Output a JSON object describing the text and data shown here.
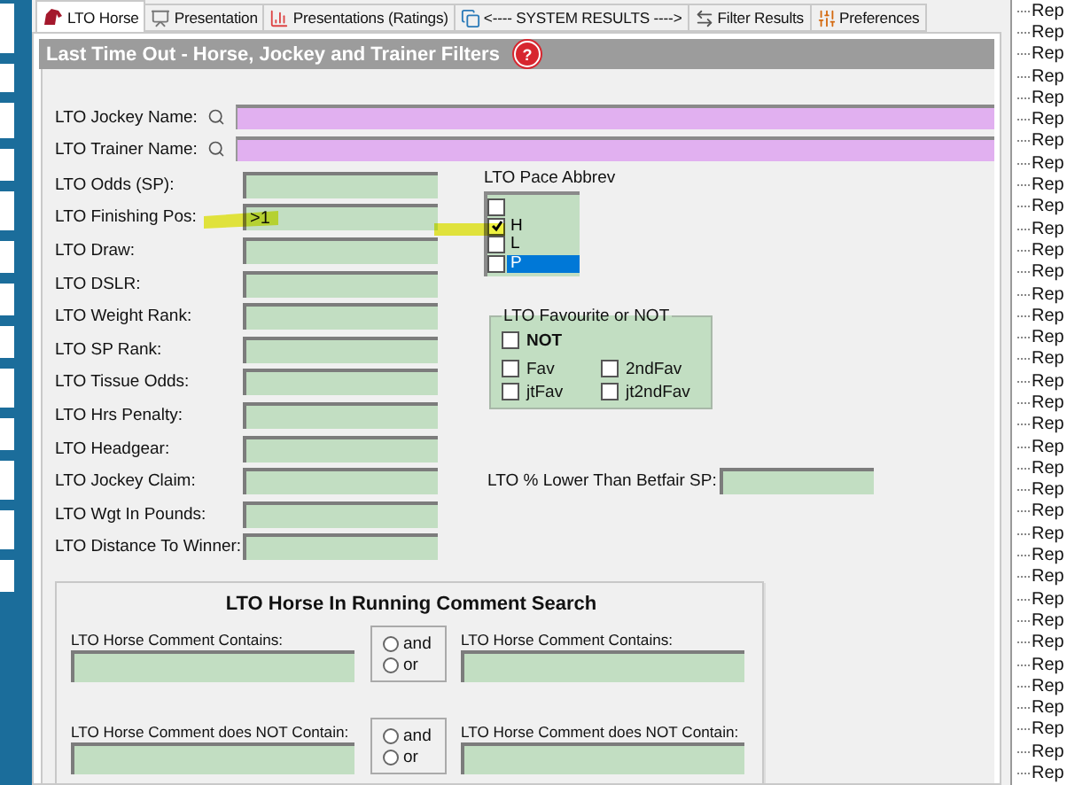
{
  "tabs": [
    {
      "label": "LTO Horse",
      "selected": true
    },
    {
      "label": "Presentation",
      "selected": false
    },
    {
      "label": "Presentations (Ratings)",
      "selected": false
    },
    {
      "label": "<---- SYSTEM RESULTS ---->",
      "selected": false
    },
    {
      "label": "Filter Results",
      "selected": false
    },
    {
      "label": "Preferences",
      "selected": false
    }
  ],
  "header": {
    "title": "Last Time Out - Horse, Jockey and Trainer Filters",
    "help": "?"
  },
  "name_filters": [
    {
      "label": "LTO Jockey Name:"
    },
    {
      "label": "LTO Trainer Name:"
    }
  ],
  "filters": [
    {
      "label": "LTO Odds (SP):"
    },
    {
      "label": "LTO Finishing Pos:",
      "value": ">1"
    },
    {
      "label": "LTO Draw:"
    },
    {
      "label": "LTO DSLR:"
    },
    {
      "label": "LTO Weight Rank:"
    },
    {
      "label": "LTO SP Rank:"
    },
    {
      "label": "LTO Tissue Odds:"
    },
    {
      "label": "LTO Hrs Penalty:"
    },
    {
      "label": "LTO Headgear:"
    },
    {
      "label": "LTO Jockey Claim:"
    },
    {
      "label": "LTO Wgt In Pounds:"
    },
    {
      "label": "LTO Distance To Winner:"
    }
  ],
  "pace": {
    "label": "LTO Pace Abbrev",
    "options": [
      {
        "checked": false,
        "selected": false
      },
      {
        "label": "H",
        "checked": true,
        "selected": false
      },
      {
        "label": "L",
        "checked": false,
        "selected": false
      },
      {
        "label": "P",
        "checked": false,
        "selected": true
      }
    ]
  },
  "favourite": {
    "title": "LTO Favourite or NOT",
    "not": {
      "label": "NOT",
      "checked": false
    },
    "options": [
      {
        "label": "Fav",
        "checked": false
      },
      {
        "label": "2ndFav",
        "checked": false
      },
      {
        "label": "jtFav",
        "checked": false
      },
      {
        "label": "jt2ndFav",
        "checked": false
      }
    ]
  },
  "betfair": {
    "label": "LTO % Lower Than Betfair SP:"
  },
  "comment_search": {
    "title": "LTO Horse In Running Comment Search",
    "rows": [
      {
        "left_label": "LTO Horse Comment Contains:",
        "right_label": "LTO Horse Comment Contains:",
        "radios": [
          {
            "label": "and",
            "selected": false
          },
          {
            "label": "or",
            "selected": false
          }
        ]
      },
      {
        "left_label": "LTO Horse Comment does NOT Contain:",
        "right_label": "LTO Horse Comment does NOT Contain:",
        "radios": [
          {
            "label": "and",
            "selected": false
          },
          {
            "label": "or",
            "selected": false
          }
        ]
      }
    ]
  },
  "tree": {
    "items": [
      "Rep",
      "Rep",
      "Rep",
      "Rep",
      "Rep",
      "Rep",
      "Rep",
      "Rep",
      "Rep",
      "Rep",
      "Rep",
      "Rep",
      "Rep",
      "Rep",
      "Rep",
      "Rep",
      "Rep",
      "Rep",
      "Rep",
      "Rep",
      "Rep",
      "Rep",
      "Rep",
      "Rep",
      "Rep",
      "Rep",
      "Rep",
      "Rep",
      "Rep",
      "Rep",
      "Rep",
      "Rep",
      "Rep",
      "Rep",
      "Rep",
      "Rep"
    ]
  }
}
